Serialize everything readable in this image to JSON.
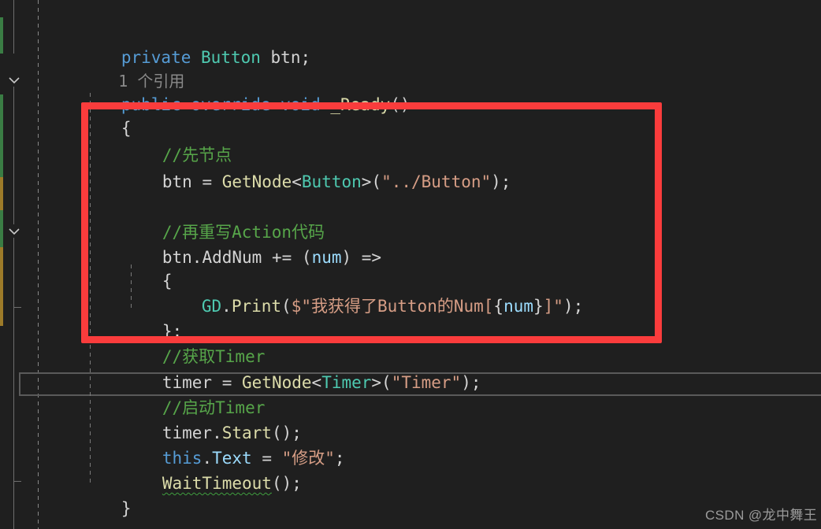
{
  "editor": {
    "background": "#1f1f1f",
    "default_text_color": "#d4d4d4",
    "font_size_px": 21,
    "line_height_px": 30
  },
  "colors": {
    "keyword": "#569cd6",
    "type": "#4ec9b0",
    "method": "#dcdcaa",
    "string": "#d69d85",
    "comment": "#57a64a",
    "parameter": "#9cdcfe",
    "plain": "#d4d4d4",
    "codelens": "#8a8a8a",
    "annotation_red": "#fa3c3c",
    "current_line_border": "#5a5a5a",
    "change_bar_green": "#3a7d44",
    "change_bar_orange": "#9d7b29",
    "fold_line": "#6e6e6e",
    "indent_guide": "#7a7a7a",
    "squiggle_green": "#3f9f3f"
  },
  "codelens": {
    "text": "1 个引用"
  },
  "code_lines": [
    {
      "id": "line-private-button-btn",
      "text": "private Button btn;",
      "tokens": [
        {
          "t": "private",
          "c": "kw"
        },
        {
          "t": " ",
          "c": "plain"
        },
        {
          "t": "Button",
          "c": "type"
        },
        {
          "t": " btn;",
          "c": "plain"
        }
      ]
    },
    {
      "id": "line-codelens",
      "text": "1 个引用",
      "tokens": [
        {
          "t": "1 个引用",
          "c": "lens"
        }
      ]
    },
    {
      "id": "line-ready-signature",
      "text": "public override void _Ready()",
      "tokens": [
        {
          "t": "public override void ",
          "c": "kw"
        },
        {
          "t": "_Ready",
          "c": "meth"
        },
        {
          "t": "()",
          "c": "punc"
        }
      ]
    },
    {
      "id": "line-open-brace-ready",
      "text": "{",
      "tokens": [
        {
          "t": "{",
          "c": "punc"
        }
      ]
    },
    {
      "id": "line-comment-get-node",
      "text": "//先节点",
      "tokens": [
        {
          "t": "//先节点",
          "c": "cmt"
        }
      ]
    },
    {
      "id": "line-btn-getnode",
      "text": "btn = GetNode<Button>(\"../Button\");",
      "tokens": [
        {
          "t": "btn ",
          "c": "plain"
        },
        {
          "t": "= ",
          "c": "punc"
        },
        {
          "t": "GetNode",
          "c": "meth"
        },
        {
          "t": "<",
          "c": "punc"
        },
        {
          "t": "Button",
          "c": "type"
        },
        {
          "t": ">(",
          "c": "punc"
        },
        {
          "t": "\"../Button\"",
          "c": "str"
        },
        {
          "t": ");",
          "c": "punc"
        }
      ]
    },
    {
      "id": "line-blank-1",
      "text": "",
      "tokens": []
    },
    {
      "id": "line-comment-rewrite-action",
      "text": "//再重写Action代码",
      "tokens": [
        {
          "t": "//再重写Action代码",
          "c": "cmt"
        }
      ]
    },
    {
      "id": "line-btn-addnum",
      "text": "btn.AddNum += (num) =>",
      "tokens": [
        {
          "t": "btn",
          "c": "plain"
        },
        {
          "t": ".",
          "c": "punc"
        },
        {
          "t": "AddNum ",
          "c": "plain"
        },
        {
          "t": "+= ",
          "c": "punc"
        },
        {
          "t": "(",
          "c": "punc"
        },
        {
          "t": "num",
          "c": "param"
        },
        {
          "t": ") =>",
          "c": "punc"
        }
      ]
    },
    {
      "id": "line-open-brace-lambda",
      "text": "{",
      "tokens": [
        {
          "t": "{",
          "c": "punc"
        }
      ]
    },
    {
      "id": "line-gd-print",
      "text": "GD.Print($\"我获得了Button的Num[{num}]\");",
      "tokens": [
        {
          "t": "GD",
          "c": "type"
        },
        {
          "t": ".",
          "c": "punc"
        },
        {
          "t": "Print",
          "c": "meth"
        },
        {
          "t": "(",
          "c": "punc"
        },
        {
          "t": "$\"我获得了Button的Num[",
          "c": "str"
        },
        {
          "t": "{",
          "c": "punc"
        },
        {
          "t": "num",
          "c": "param"
        },
        {
          "t": "}",
          "c": "punc"
        },
        {
          "t": "]\"",
          "c": "str"
        },
        {
          "t": ");",
          "c": "punc"
        }
      ]
    },
    {
      "id": "line-close-brace-lambda",
      "text": "};",
      "tokens": [
        {
          "t": "};",
          "c": "punc"
        }
      ]
    },
    {
      "id": "line-comment-get-timer",
      "text": "//获取Timer",
      "tokens": [
        {
          "t": "//获取Timer",
          "c": "cmt"
        }
      ]
    },
    {
      "id": "line-timer-getnode",
      "text": "timer = GetNode<Timer>(\"Timer\");",
      "tokens": [
        {
          "t": "timer ",
          "c": "plain"
        },
        {
          "t": "= ",
          "c": "punc"
        },
        {
          "t": "GetNode",
          "c": "meth"
        },
        {
          "t": "<",
          "c": "punc"
        },
        {
          "t": "Timer",
          "c": "type"
        },
        {
          "t": ">(",
          "c": "punc"
        },
        {
          "t": "\"Timer\"",
          "c": "str"
        },
        {
          "t": ");",
          "c": "punc"
        }
      ]
    },
    {
      "id": "line-comment-start-timer",
      "text": "//启动Timer",
      "tokens": [
        {
          "t": "//启动Timer",
          "c": "cmt"
        }
      ]
    },
    {
      "id": "line-timer-start",
      "text": "timer.Start();",
      "tokens": [
        {
          "t": "timer",
          "c": "plain"
        },
        {
          "t": ".",
          "c": "punc"
        },
        {
          "t": "Start",
          "c": "meth"
        },
        {
          "t": "();",
          "c": "punc"
        }
      ]
    },
    {
      "id": "line-this-text",
      "text": "this.Text = \"修改\";",
      "tokens": [
        {
          "t": "this",
          "c": "kw"
        },
        {
          "t": ".",
          "c": "punc"
        },
        {
          "t": "Text ",
          "c": "prop"
        },
        {
          "t": "= ",
          "c": "punc"
        },
        {
          "t": "\"修改\"",
          "c": "str"
        },
        {
          "t": ";",
          "c": "punc"
        }
      ]
    },
    {
      "id": "line-wait-timeout",
      "text": "WaitTimeout();",
      "tokens": [
        {
          "t": "WaitTimeout",
          "c": "meth squiggle"
        },
        {
          "t": "();",
          "c": "punc"
        }
      ]
    },
    {
      "id": "line-close-brace-ready",
      "text": "}",
      "tokens": [
        {
          "t": "}",
          "c": "punc"
        }
      ]
    }
  ],
  "watermark": {
    "text": "CSDN @龙中舞王"
  },
  "annotation": {
    "label": "red-highlight-rectangle",
    "color": "#fa3c3c"
  }
}
